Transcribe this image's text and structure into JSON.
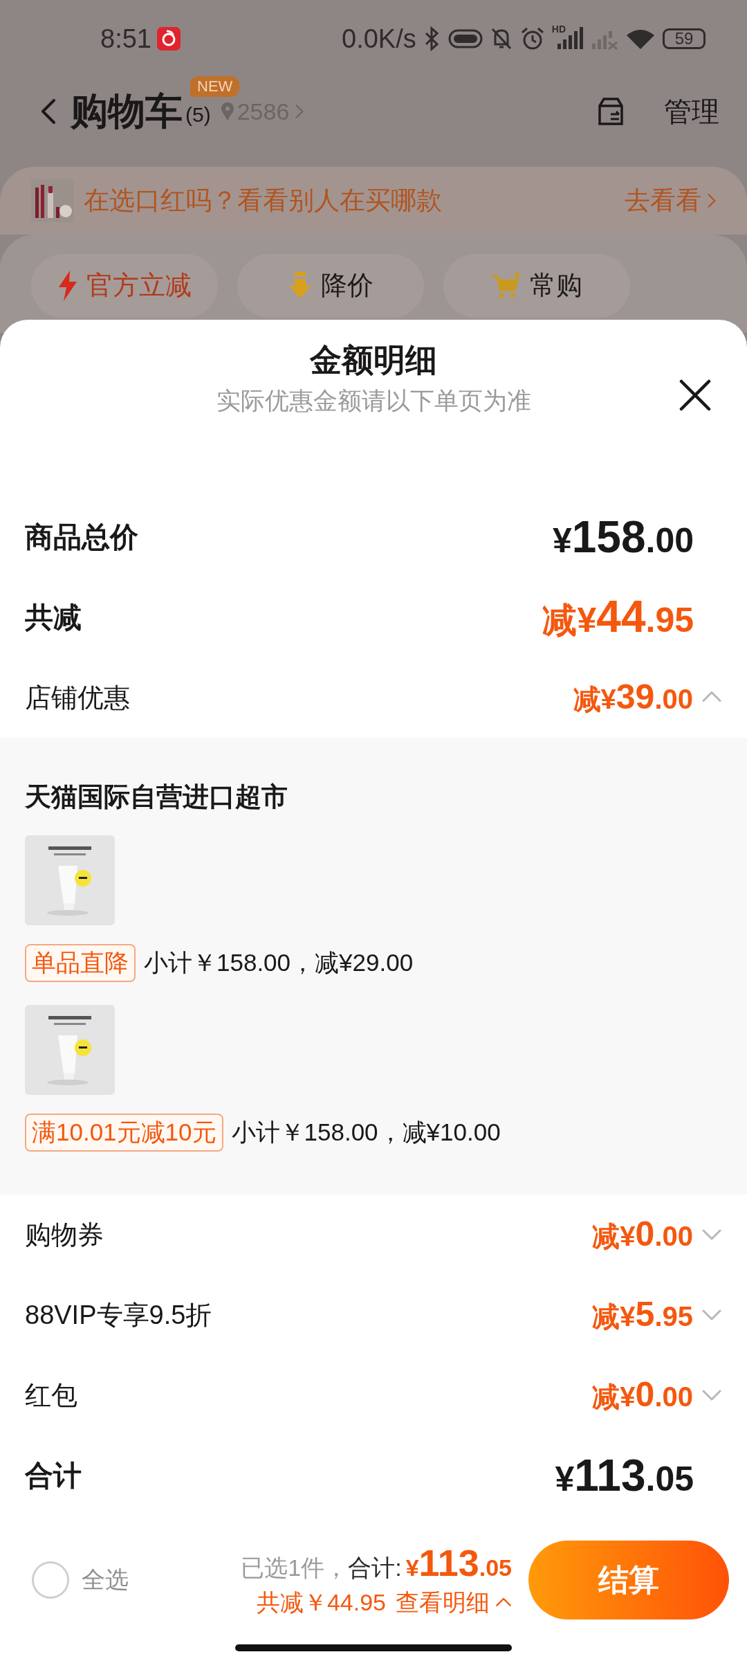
{
  "status_bar": {
    "time": "8:51",
    "network_speed": "0.0K/s",
    "hd_label": "HD",
    "battery": "59"
  },
  "header": {
    "title": "购物车",
    "count": "(5)",
    "badge": "NEW",
    "location": "2586",
    "manage": "管理"
  },
  "banner": {
    "text": "在选口红吗？看看别人在买哪款",
    "link": "去看看"
  },
  "quick_filters": [
    {
      "label": "官方立减",
      "kind": "official"
    },
    {
      "label": "降价",
      "kind": "price-drop"
    },
    {
      "label": "常购",
      "kind": "frequent"
    }
  ],
  "sheet": {
    "title": "金额明细",
    "subtitle": "实际优惠金额请以下单页为准",
    "rows": [
      {
        "kind": "price",
        "label": "商品总价",
        "amount": "¥158.00"
      },
      {
        "kind": "reduction",
        "label": "共减",
        "amount": "减¥44.95"
      },
      {
        "kind": "discount",
        "label": "店铺优惠",
        "amount": "减¥39.00",
        "expanded": true,
        "store": {
          "name": "天猫国际自营进口超市",
          "items": [
            {
              "tag": "单品直降",
              "detail": "小计￥158.00，减¥29.00"
            },
            {
              "tag": "满10.01元减10元",
              "detail": "小计￥158.00，减¥10.00"
            }
          ]
        }
      },
      {
        "kind": "discount",
        "label": "购物券",
        "amount": "减¥0.00",
        "expanded": false
      },
      {
        "kind": "discount",
        "label": "88VIP专享9.5折",
        "amount": "减¥5.95",
        "expanded": false
      },
      {
        "kind": "discount",
        "label": "红包",
        "amount": "减¥0.00",
        "expanded": false
      },
      {
        "kind": "price",
        "label": "合计",
        "amount": "¥113.05"
      }
    ]
  },
  "footer": {
    "select_all": {
      "label": "全选",
      "checked": false
    },
    "selected_count": "已选1件，",
    "total_label": "合计:",
    "total": "¥113.05",
    "saving": "共减￥44.95",
    "details_link": "查看明细",
    "checkout": "结算"
  }
}
